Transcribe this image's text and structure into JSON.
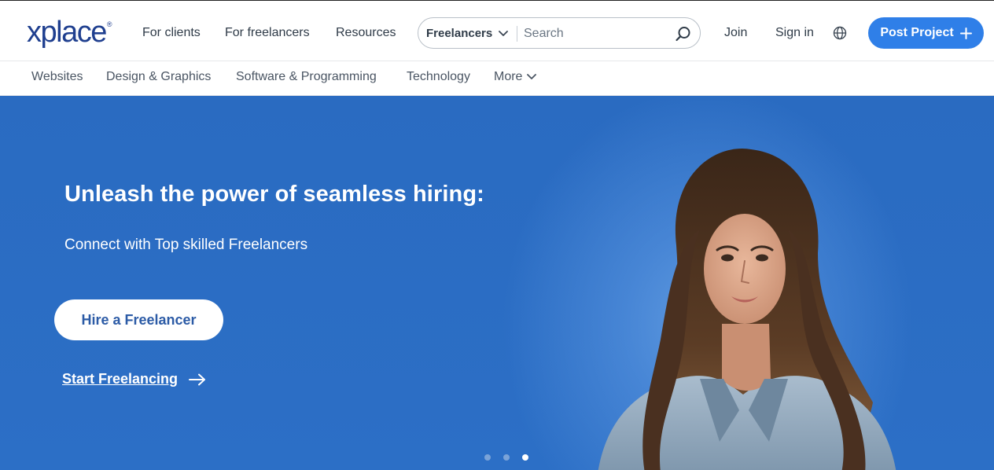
{
  "header": {
    "logo_text": "xplace",
    "logo_mark": "®",
    "nav": [
      "For clients",
      "For freelancers",
      "Resources"
    ],
    "search": {
      "category": "Freelancers",
      "placeholder": "Search"
    },
    "join_label": "Join",
    "signin_label": "Sign in",
    "post_project_label": "Post Project",
    "post_project_icon": "plus-icon"
  },
  "categories": [
    "Websites",
    "Design & Graphics",
    "Software & Programming",
    "Technology",
    "More"
  ],
  "hero": {
    "title": "Unleash the power of seamless hiring:",
    "subtitle": "Connect with Top skilled Freelancers",
    "hire_button": "Hire a Freelancer",
    "start_link": "Start Freelancing",
    "slide_count": 3,
    "active_slide": 3
  },
  "colors": {
    "brand": "#1f3f8f",
    "accent": "#2f7fe8",
    "hero_bg": "#2c6fc6"
  }
}
